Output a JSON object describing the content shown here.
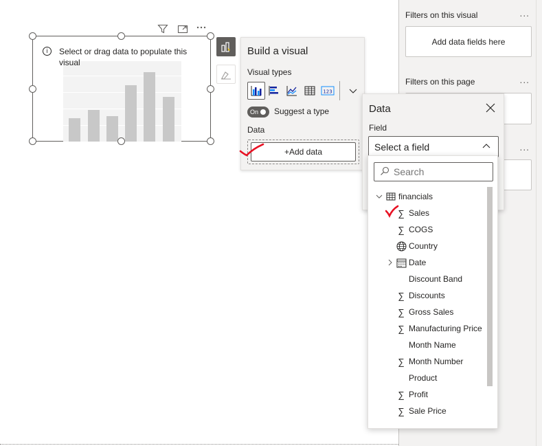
{
  "visual": {
    "message": "Select or drag data to populate this visual"
  },
  "build_panel": {
    "title": "Build a visual",
    "visual_types_label": "Visual types",
    "suggest_toggle_state": "On",
    "suggest_label": "Suggest a type",
    "data_label": "Data",
    "add_data_label": "+Add data"
  },
  "data_panel": {
    "title": "Data",
    "field_label": "Field",
    "select_placeholder": "Select a field",
    "search_placeholder": "Search",
    "table": {
      "name": "financials",
      "fields": [
        {
          "label": "Sales",
          "icon": "sigma-icon",
          "checked": true
        },
        {
          "label": "COGS",
          "icon": "sigma-icon"
        },
        {
          "label": "Country",
          "icon": "globe-icon"
        },
        {
          "label": "Date",
          "icon": "calendar-icon",
          "expandable": true
        },
        {
          "label": "Discount Band",
          "icon": ""
        },
        {
          "label": "Discounts",
          "icon": "sigma-icon"
        },
        {
          "label": "Gross Sales",
          "icon": "sigma-icon"
        },
        {
          "label": "Manufacturing Price",
          "icon": "sigma-icon"
        },
        {
          "label": "Month Name",
          "icon": ""
        },
        {
          "label": "Month Number",
          "icon": "sigma-icon"
        },
        {
          "label": "Product",
          "icon": ""
        },
        {
          "label": "Profit",
          "icon": "sigma-icon"
        },
        {
          "label": "Sale Price",
          "icon": "sigma-icon"
        }
      ]
    }
  },
  "filter_pane": {
    "on_visual_title": "Filters on this visual",
    "on_visual_box": "Add data fields here",
    "on_page_title": "Filters on this page",
    "more": "..."
  },
  "colors": {
    "accent_dark": "#605e5c",
    "pane_bg": "#f3f2f1",
    "annotation_red": "#e81123"
  }
}
